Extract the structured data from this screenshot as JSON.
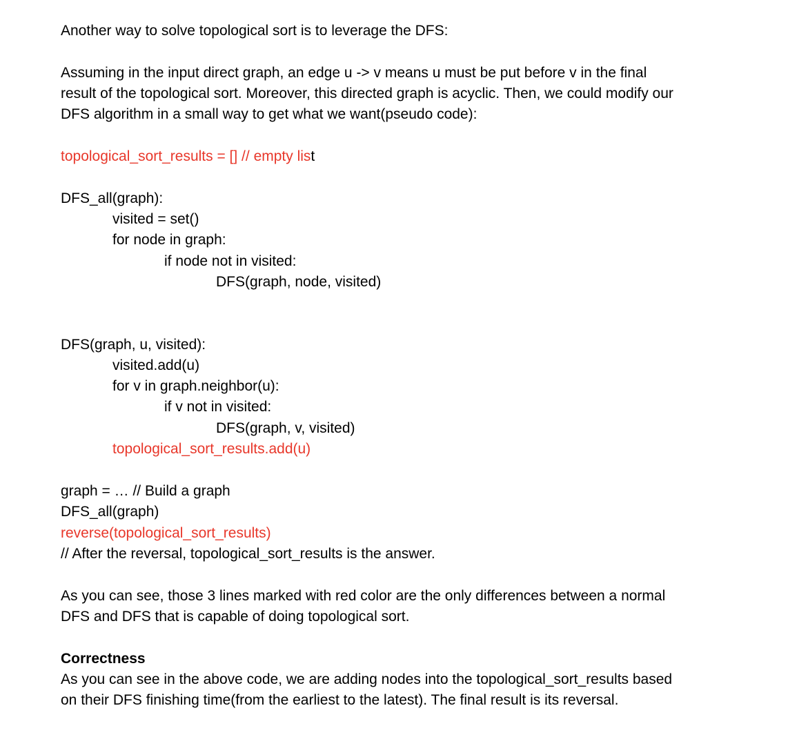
{
  "intro": "Another way to solve topological sort is to leverage the DFS:",
  "assumption": [
    "Assuming in the input direct graph, an edge u -> v means u must be put before v in the final",
    "result of the topological sort. Moreover, this directed graph is acyclic. Then, we could modify our",
    "DFS algorithm in a small way to get what we want(pseudo code):"
  ],
  "results_init": {
    "red_part": "topological_sort_results = [] // empty lis",
    "black_part": "t"
  },
  "dfs_all": {
    "signature": "DFS_all(graph):",
    "line1": "visited = set()",
    "line2": "for node in graph:",
    "line3": "if node not in visited:",
    "line4": "DFS(graph, node, visited)"
  },
  "dfs": {
    "signature": "DFS(graph, u, visited):",
    "line1": "visited.add(u)",
    "line2": "for v in graph.neighbor(u):",
    "line3": "if v not in visited:",
    "line4": "DFS(graph, v, visited)",
    "line5": "topological_sort_results.add(u)"
  },
  "main": {
    "line1": "graph = … // Build a graph",
    "line2": "DFS_all(graph)",
    "line3": "reverse(topological_sort_results)",
    "line4": "// After the reversal, topological_sort_results is the answer."
  },
  "note": [
    "As you can see, those 3 lines marked with red color are the only differences between a normal",
    "DFS and DFS that is capable of doing topological sort."
  ],
  "correctness": {
    "heading": "Correctness",
    "lines": [
      "As you can see in the above code, we are adding nodes into the topological_sort_results based",
      "on their DFS finishing time(from the earliest to the latest). The final result is its reversal."
    ]
  },
  "colors": {
    "highlight": "#e8372a",
    "text": "#000000"
  }
}
